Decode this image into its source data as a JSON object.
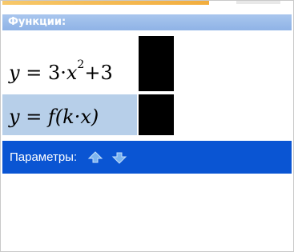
{
  "panel": {
    "functions_header": "Функции:",
    "functions": [
      {
        "lhs": "y",
        "eq": "=",
        "rhs_part1": "3",
        "dot": "·",
        "var": "x",
        "exponent": "2",
        "rhs_part2": "+3",
        "swatch_color": "#000000"
      },
      {
        "expression": "y = f(k·x)",
        "swatch_color": "#000000"
      }
    ],
    "params_label": "Параметры:",
    "params_up_icon": "arrow-up-icon",
    "params_down_icon": "arrow-down-icon"
  },
  "colors": {
    "header_bg": "#9dbceb",
    "selected_row_bg": "#b7cfe9",
    "params_bar_bg": "#0a55d3",
    "arrow_color": "#6fa8e8"
  }
}
